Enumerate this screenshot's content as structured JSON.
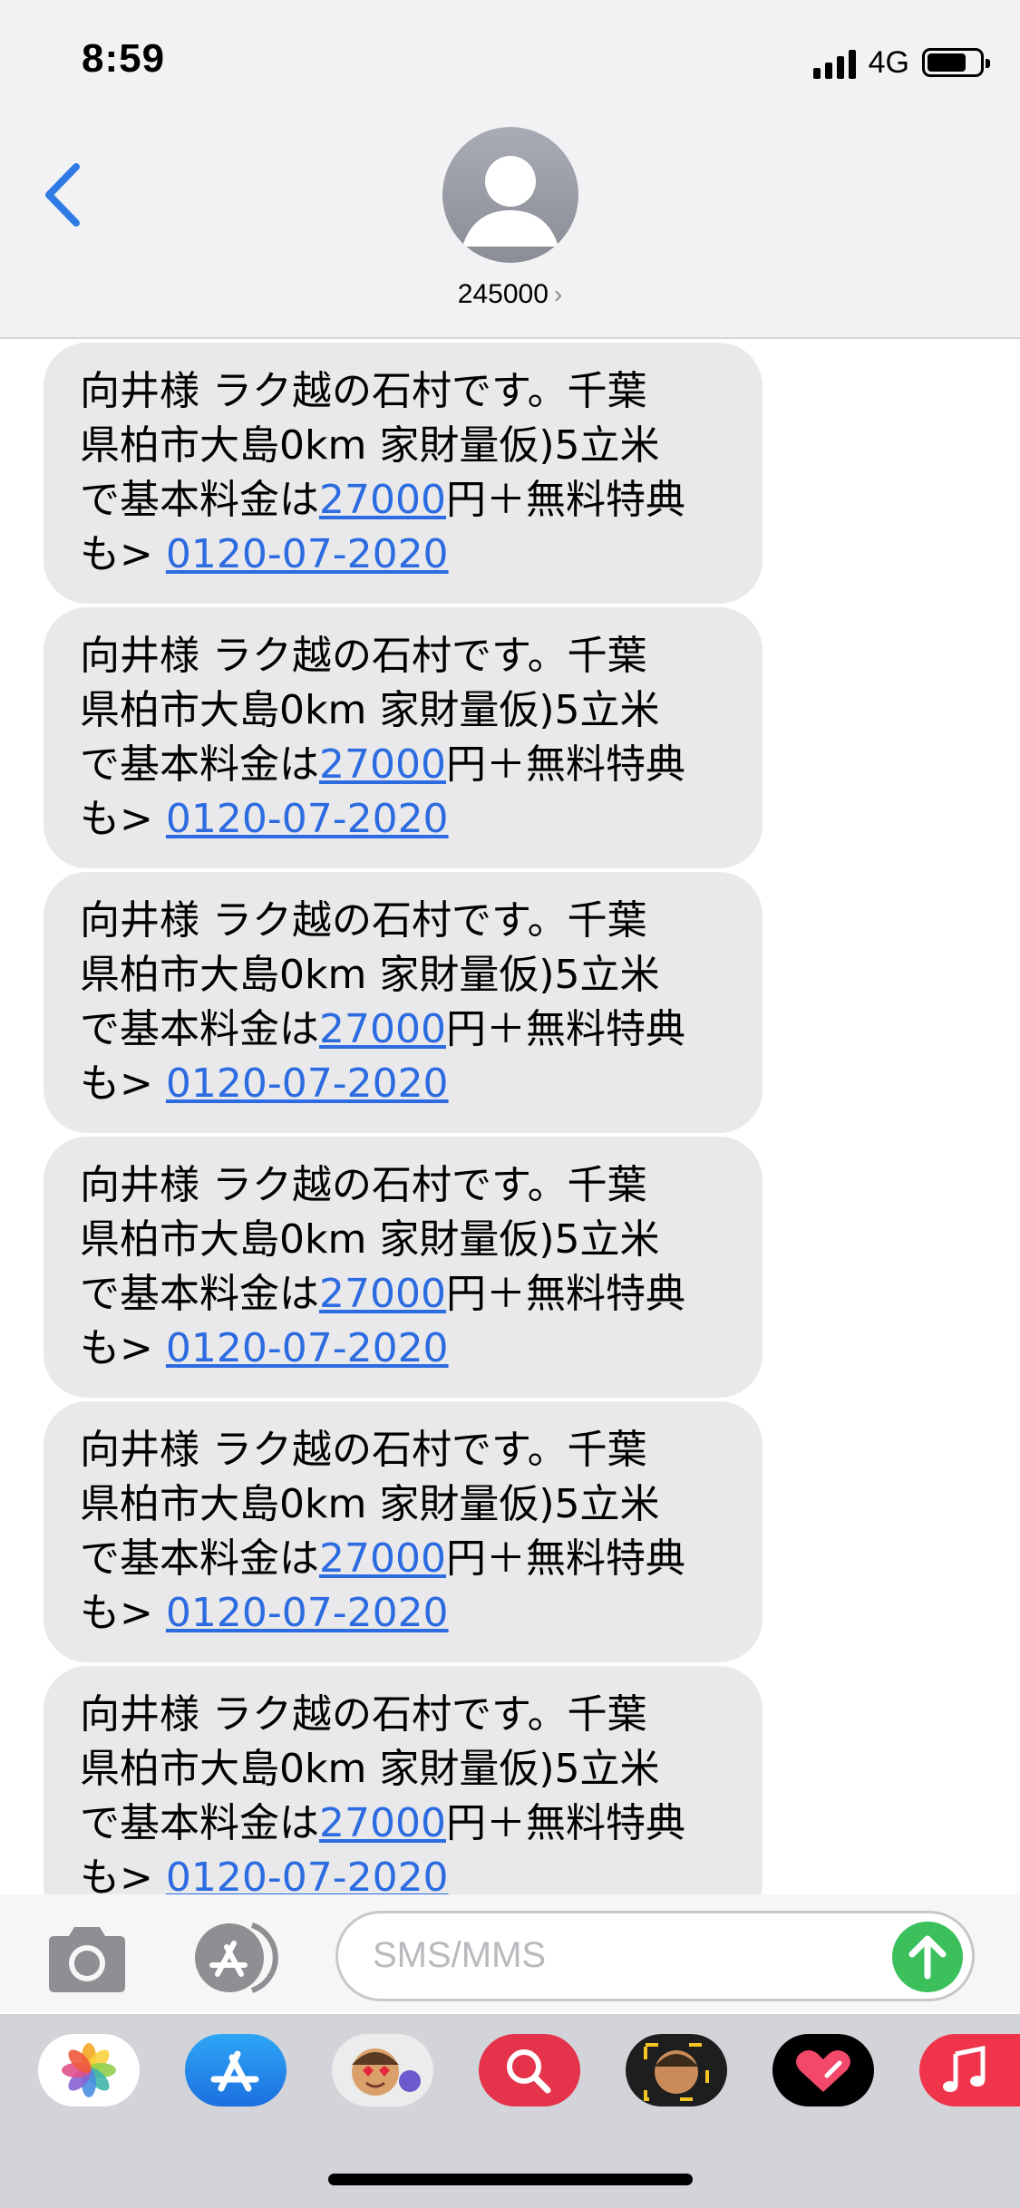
{
  "status_bar": {
    "time": "8:59",
    "network": "4G"
  },
  "header": {
    "contact_name": "245000",
    "contact_chevron": "›"
  },
  "messages": [
    {
      "line1": "向井様 ラク越の石村です。千葉",
      "line2": "県柏市大島0km 家財量仮)5立米",
      "line3_pre": "で基本料金は",
      "price_link": "27000",
      "line3_post": "円＋無料特典",
      "line4_pre": "も> ",
      "phone_link": "0120-07-2020"
    },
    {
      "line1": "向井様 ラク越の石村です。千葉",
      "line2": "県柏市大島0km 家財量仮)5立米",
      "line3_pre": "で基本料金は",
      "price_link": "27000",
      "line3_post": "円＋無料特典",
      "line4_pre": "も> ",
      "phone_link": "0120-07-2020"
    },
    {
      "line1": "向井様 ラク越の石村です。千葉",
      "line2": "県柏市大島0km 家財量仮)5立米",
      "line3_pre": "で基本料金は",
      "price_link": "27000",
      "line3_post": "円＋無料特典",
      "line4_pre": "も> ",
      "phone_link": "0120-07-2020"
    },
    {
      "line1": "向井様 ラク越の石村です。千葉",
      "line2": "県柏市大島0km 家財量仮)5立米",
      "line3_pre": "で基本料金は",
      "price_link": "27000",
      "line3_post": "円＋無料特典",
      "line4_pre": "も> ",
      "phone_link": "0120-07-2020"
    },
    {
      "line1": "向井様 ラク越の石村です。千葉",
      "line2": "県柏市大島0km 家財量仮)5立米",
      "line3_pre": "で基本料金は",
      "price_link": "27000",
      "line3_post": "円＋無料特典",
      "line4_pre": "も> ",
      "phone_link": "0120-07-2020"
    },
    {
      "line1": "向井様 ラク越の石村です。千葉",
      "line2": "県柏市大島0km 家財量仮)5立米",
      "line3_pre": "で基本料金は",
      "price_link": "27000",
      "line3_post": "円＋無料特典",
      "line4_pre": "も> ",
      "phone_link": "0120-07-2020"
    }
  ],
  "input": {
    "placeholder": "SMS/MMS"
  },
  "app_drawer": [
    "photos-icon",
    "app-store-icon",
    "memoji-icon",
    "image-search-icon",
    "memoji-stickers-icon",
    "digital-touch-icon",
    "music-icon"
  ],
  "colors": {
    "link": "#2c6be0",
    "bubble": "#e9e9eb",
    "send": "#3cc05c",
    "back": "#2f7ae5"
  }
}
